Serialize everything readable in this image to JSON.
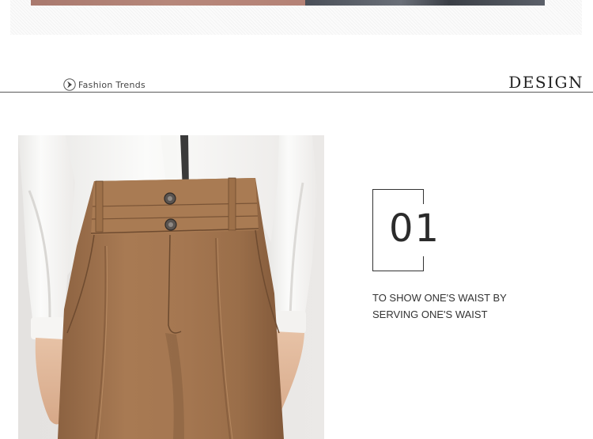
{
  "section": {
    "tag_label": "Fashion Trends",
    "title": "DESIGN"
  },
  "feature": {
    "number": "01",
    "lines": [
      "TO SHOW ONE'S WAIST BY",
      "SERVING ONE'S WAIST"
    ]
  },
  "icons": {
    "tag_icon": "chevron-right-circle-icon"
  },
  "colors": {
    "pants": "#a3764e",
    "shirt": "#f4f3f1",
    "rule": "#5a5a5a",
    "text": "#333333"
  }
}
